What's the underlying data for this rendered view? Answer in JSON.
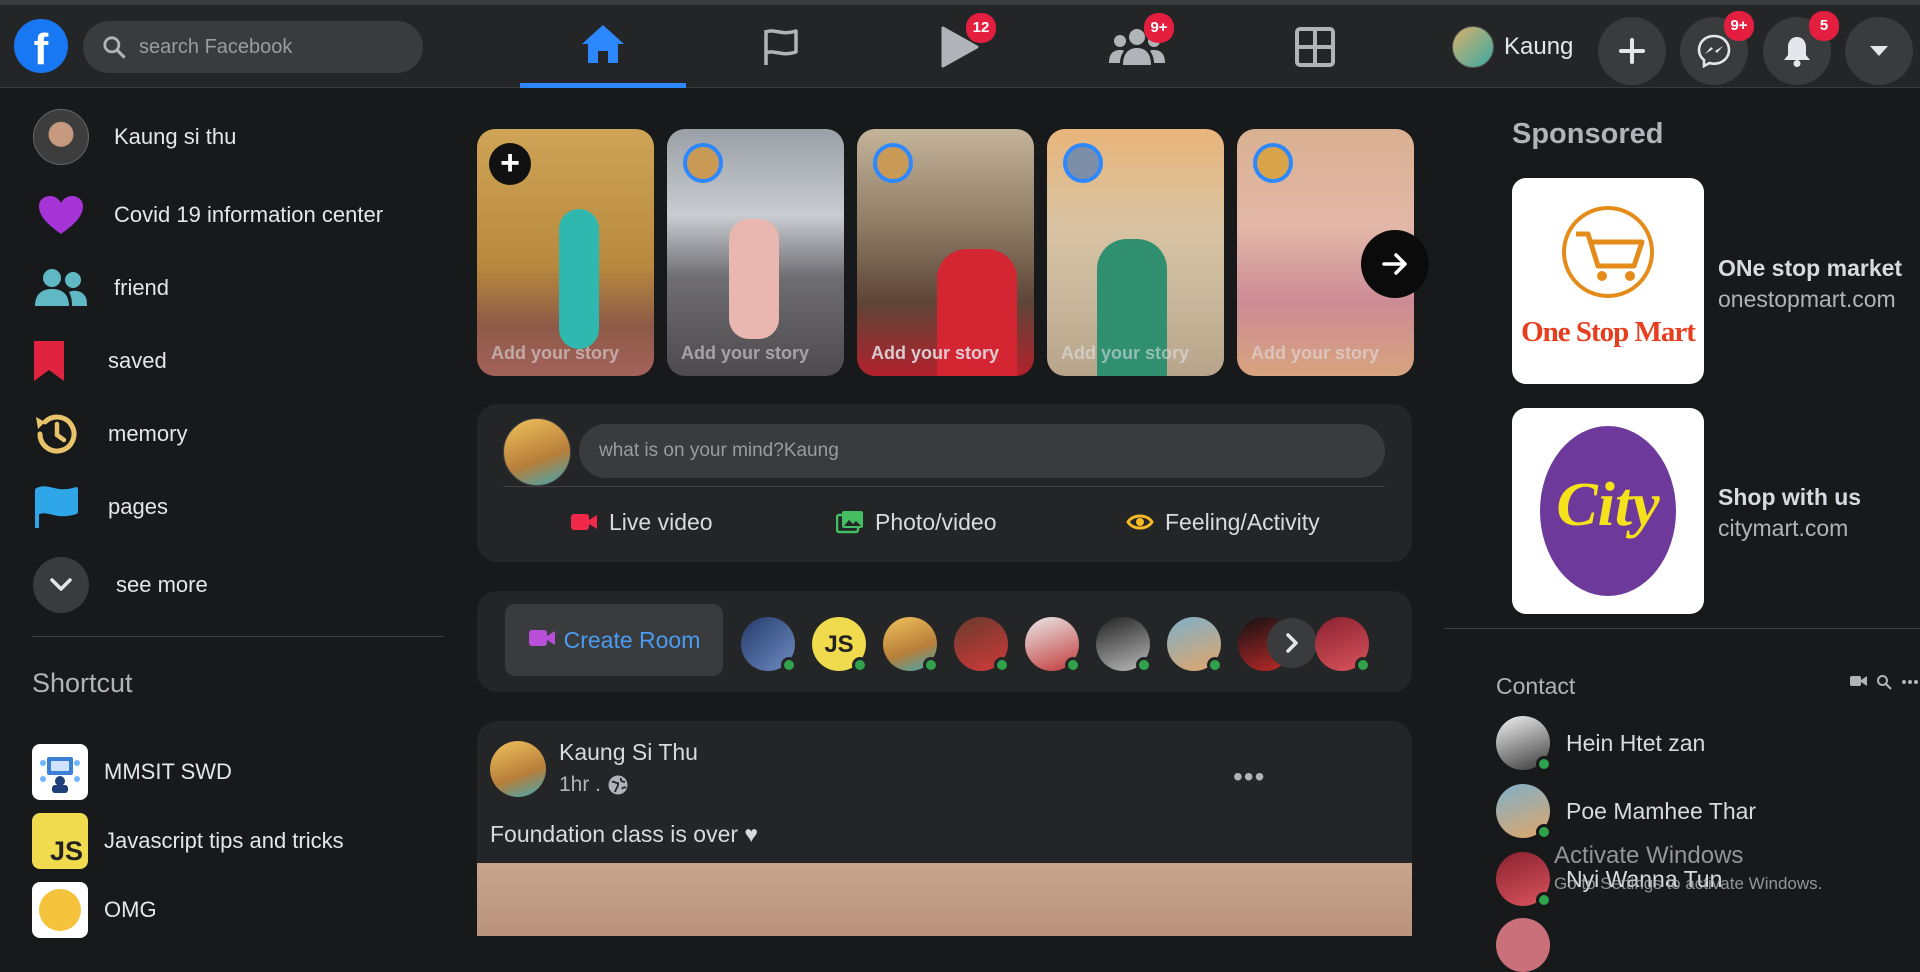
{
  "header": {
    "search_placeholder": "search Facebook",
    "badges": {
      "watch": "12",
      "groups": "9+",
      "messenger": "9+",
      "notifications": "5"
    },
    "profile_name": "Kaung"
  },
  "sidebar": {
    "items": [
      {
        "label": "Kaung si thu",
        "icon": "user-avatar"
      },
      {
        "label": "Covid 19 information center",
        "icon": "heart-icon"
      },
      {
        "label": "friend",
        "icon": "friends-icon"
      },
      {
        "label": "saved",
        "icon": "bookmark-icon"
      },
      {
        "label": "memory",
        "icon": "history-clock-icon"
      },
      {
        "label": "pages",
        "icon": "flag-icon"
      },
      {
        "label": "see more",
        "icon": "chevron-down-icon"
      }
    ],
    "shortcut_title": "Shortcut",
    "shortcuts": [
      {
        "label": "MMSIT SWD"
      },
      {
        "label": "Javascript tips and tricks",
        "thumb_text": "JS"
      },
      {
        "label": "OMG"
      }
    ]
  },
  "stories": [
    {
      "label": "Add your story"
    },
    {
      "label": "Add your story"
    },
    {
      "label": "Add your story"
    },
    {
      "label": "Add your story"
    },
    {
      "label": "Add your story"
    }
  ],
  "composer": {
    "placeholder": "what is on your mind?Kaung",
    "live_label": "Live video",
    "photo_label": "Photo/video",
    "feeling_label": "Feeling/Activity"
  },
  "rooms": {
    "create_label": "Create Room",
    "js_avatar_text": "JS"
  },
  "post": {
    "author": "Kaung Si Thu",
    "time": "1hr .",
    "text": "Foundation class is over ♥"
  },
  "sponsored": {
    "title": "Sponsored",
    "ads": [
      {
        "name": "ONe stop market",
        "url": "onestopmart.com",
        "logo_text": "One Stop Mart"
      },
      {
        "name": "Shop with us",
        "url": "citymart.com",
        "logo_text": "City"
      }
    ]
  },
  "contacts": {
    "title": "Contact",
    "people": [
      {
        "name": "Hein Htet zan"
      },
      {
        "name": "Poe Mamhee Thar"
      },
      {
        "name": "Nyi Wanna Tun"
      }
    ]
  },
  "watermark": {
    "line1": "Activate Windows",
    "line2": "Go to Settings to activate Windows."
  },
  "colors": {
    "accent": "#2d88ff",
    "badge": "#e41e3f",
    "online": "#31a24c",
    "background": "#18191a",
    "card": "#242526"
  }
}
